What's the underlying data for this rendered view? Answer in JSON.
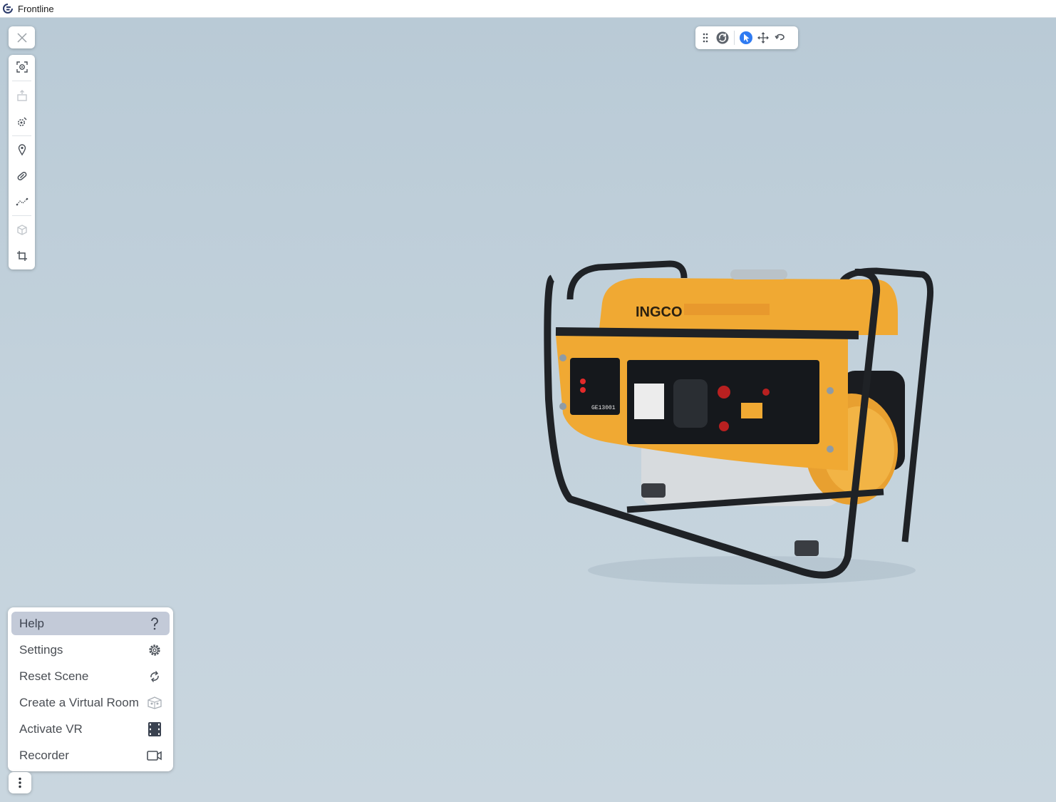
{
  "window": {
    "title": "Frontline",
    "logo_icon": "frontline-logo-icon"
  },
  "left_toolbar": {
    "close_icon": "close-icon",
    "tools": [
      {
        "name": "focus-view-tool",
        "icon": "focus-target-icon",
        "enabled": true
      },
      {
        "name": "explode-tool",
        "icon": "box-lift-icon",
        "enabled": false
      },
      {
        "name": "section-tool",
        "icon": "gear-eye-icon",
        "enabled": true
      },
      {
        "name": "annotation-tool",
        "icon": "map-pin-icon",
        "enabled": true
      },
      {
        "name": "attach-tool",
        "icon": "link-icon",
        "enabled": true
      },
      {
        "name": "path-tool",
        "icon": "path-nodes-icon",
        "enabled": true
      },
      {
        "name": "isolate-tool",
        "icon": "cube-icon",
        "enabled": false
      },
      {
        "name": "crop-tool",
        "icon": "crop-icon",
        "enabled": true
      }
    ]
  },
  "top_toolbar": {
    "items": [
      {
        "name": "drag-handle",
        "icon": "drag-dots-icon",
        "active": false
      },
      {
        "name": "orbit-tool",
        "icon": "orbit-icon",
        "active": false
      },
      {
        "name": "select-tool",
        "icon": "cursor-select-icon",
        "active": true
      },
      {
        "name": "move-tool",
        "icon": "move-arrows-icon",
        "active": false
      },
      {
        "name": "undo-tool",
        "icon": "undo-arrow-icon",
        "active": false
      }
    ]
  },
  "menu": {
    "items": [
      {
        "label": "Help",
        "icon": "question-icon",
        "active": true
      },
      {
        "label": "Settings",
        "icon": "gear-icon",
        "active": false
      },
      {
        "label": "Reset Scene",
        "icon": "refresh-icon",
        "active": false
      },
      {
        "label": "Create a Virtual Room",
        "icon": "virtual-room-icon",
        "active": false
      },
      {
        "label": "Activate VR",
        "icon": "film-strip-icon",
        "active": false
      },
      {
        "label": "Recorder",
        "icon": "video-camera-icon",
        "active": false
      }
    ],
    "more_icon": "vertical-dots-icon"
  },
  "model": {
    "name": "generator-3d-model",
    "brand_text": "INGCO",
    "serial_text": "GE13001",
    "colors": {
      "body": "#f0a933",
      "frame": "#1f2226",
      "panel": "#15181c",
      "accent_blue": "#2f7bf2"
    }
  },
  "colors": {
    "background": "#c4d3dd",
    "active_menu": "#c3cad8",
    "icon": "#4a5058",
    "icon_disabled": "#c3c8cd"
  }
}
